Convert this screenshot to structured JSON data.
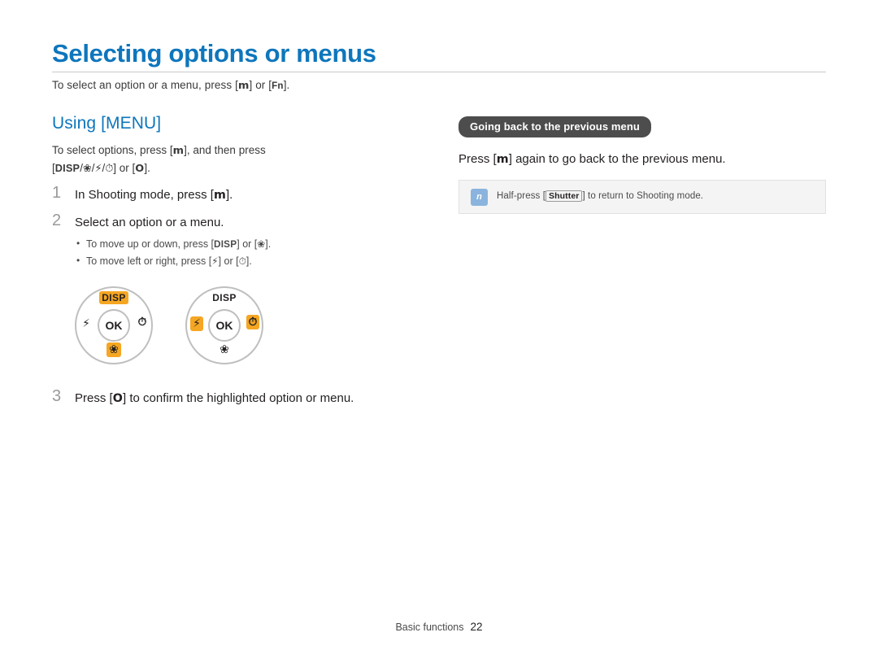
{
  "page": {
    "title": "Selecting options or menus",
    "intro_before": "To select an option or a menu, press [",
    "intro_menu": "m",
    "intro_mid": "] or [",
    "intro_fn": "Fn",
    "intro_after": "].",
    "section_heading": "Using [MENU]",
    "lead_line1_before": "To select options, press [",
    "lead_menu": "m",
    "lead_line1_after": "], and then press",
    "lead_line2_keys": "[DISP/  /  /  ] or [OK].",
    "lead_disp": "DISP",
    "lead_slash": "/",
    "lead_macro": "❀",
    "lead_flash": "⚡",
    "lead_timer": "⏱",
    "lead_or": "] or [",
    "lead_ok": "O",
    "lead_end": "]."
  },
  "steps": [
    {
      "num": "1",
      "text_before": "In Shooting mode, press [",
      "key": "m",
      "text_after": "]."
    },
    {
      "num": "2",
      "text_before": "Select an option or a menu.",
      "key": "",
      "text_after": ""
    },
    {
      "num": "3",
      "text_before": "Press [",
      "key": "O",
      "text_after": "] to confirm the highlighted option or menu."
    }
  ],
  "bullets": [
    {
      "before": "To move up or down, press [",
      "key1": "DISP",
      "middle": "] or [",
      "key2": "❀",
      "after": "]."
    },
    {
      "before": "To move left or right, press [",
      "key1": "⚡",
      "middle": "] or [",
      "key2": "⏱",
      "after": "]."
    }
  ],
  "dials": [
    {
      "name": "dial-up-down",
      "disp_label": "DISP",
      "ok_label": "OK",
      "left_glyph": "⚡",
      "right_glyph": "⏱",
      "bottom_glyph": "❀",
      "highlight": [
        "disp",
        "bottom"
      ]
    },
    {
      "name": "dial-left-right",
      "disp_label": "DISP",
      "ok_label": "OK",
      "left_glyph": "⚡",
      "right_glyph": "⏱",
      "bottom_glyph": "❀",
      "highlight": [
        "left",
        "right"
      ]
    }
  ],
  "right": {
    "heading": "Going back to the previous menu",
    "body_before": "Press [",
    "body_key": "m",
    "body_after": "] again to go back to the previous menu.",
    "note_icon": "n",
    "note_before": "Half-press [",
    "note_key": "Shutter",
    "note_after": "] to return to Shooting mode."
  },
  "footer": {
    "label": "Basic functions",
    "page_number": "22"
  },
  "colors": {
    "accent_blue": "#0e76bc",
    "highlight_orange": "#f5a623",
    "badge_gray": "#4d4d4d",
    "note_bg": "#f4f4f4",
    "note_icon_blue": "#8ab4dd"
  }
}
